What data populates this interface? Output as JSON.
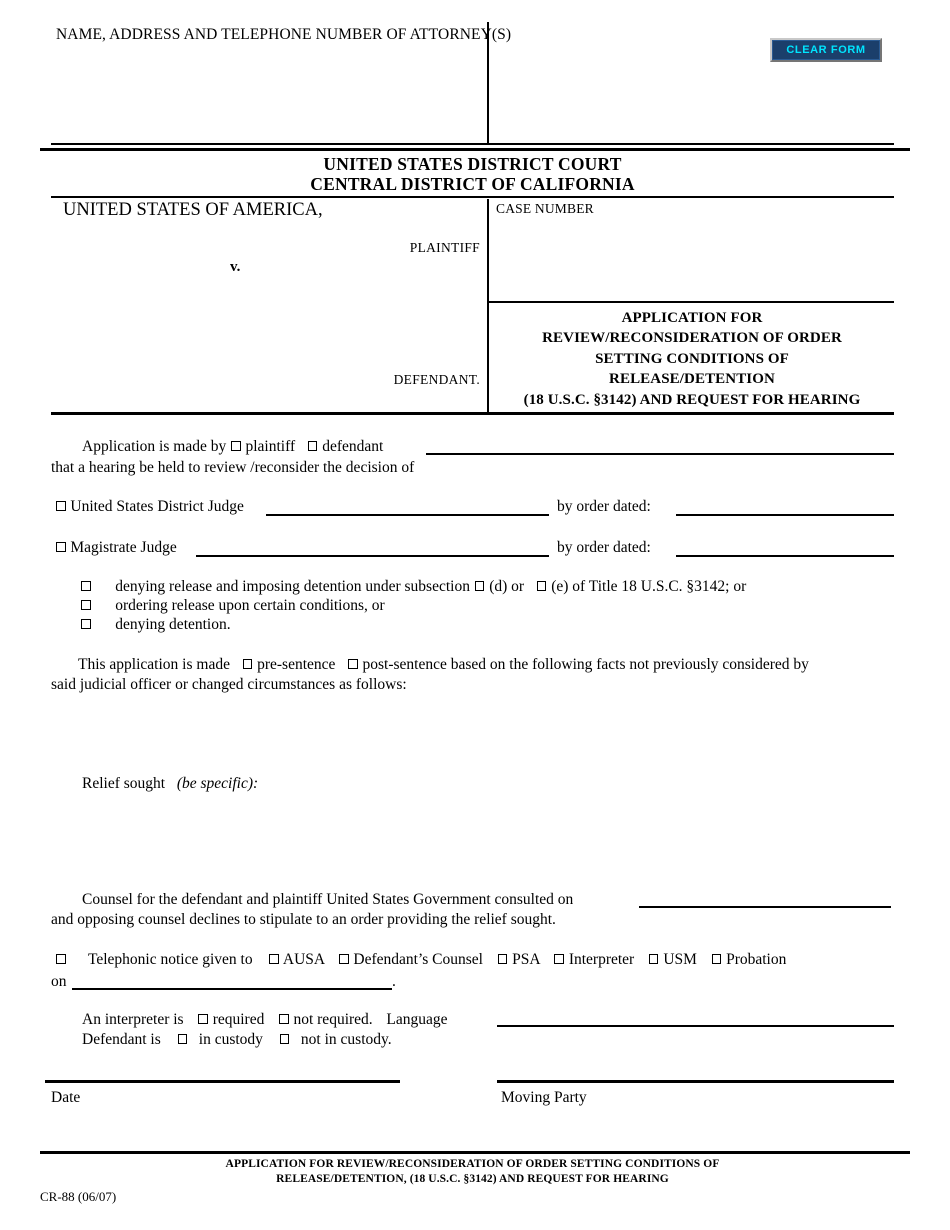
{
  "header": {
    "attorney_label": "NAME, ADDRESS AND TELEPHONE NUMBER OF ATTORNEY(S)",
    "clear_form_label": "CLEAR FORM"
  },
  "court": {
    "line1": "UNITED STATES DISTRICT COURT",
    "line2": "CENTRAL DISTRICT OF CALIFORNIA"
  },
  "caption": {
    "plaintiff_name": "UNITED STATES OF AMERICA,",
    "plaintiff_word": "PLAINTIFF",
    "versus": "v.",
    "defendant_word": "DEFENDANT.",
    "case_number_label": "CASE NUMBER",
    "case_number_value": "",
    "title_lines": [
      "APPLICATION FOR",
      "REVIEW/RECONSIDERATION OF ORDER",
      "SETTING CONDITIONS OF",
      "RELEASE/DETENTION",
      "(18 U.S.C. §3142) AND REQUEST FOR HEARING"
    ]
  },
  "application": {
    "made_by_prefix": "Application is made by",
    "plaintiff_option": "plaintiff",
    "defendant_option": "defendant",
    "made_by_value": "",
    "hearing_line": "that a hearing be held to review /reconsider the decision of",
    "district_judge_label": "United States District Judge",
    "district_judge_value": "",
    "district_order_dated_label": "by order dated:",
    "district_order_dated_value": "",
    "magistrate_judge_label": "Magistrate Judge",
    "magistrate_judge_value": "",
    "magistrate_order_dated_label": "by order dated:",
    "magistrate_order_dated_value": ""
  },
  "decision_options": {
    "item1_part1": "denying release and imposing detention under subsection",
    "item1_sub_d": "(d) or",
    "item1_sub_e": "(e) of Title 18 U.S.C. §3142; or",
    "item2": "ordering release upon certain conditions, or",
    "item3": "denying detention."
  },
  "sentence_section": {
    "prefix": "This application is made",
    "pre_sentence": "pre-sentence",
    "post_sentence": "post-sentence based on the following facts not previously considered by",
    "line2": "said judicial officer or changed circumstances as follows:",
    "facts_value": ""
  },
  "relief": {
    "label": "Relief sought",
    "label_italic": "(be specific):",
    "value": ""
  },
  "counsel": {
    "line1": "Counsel for the defendant and plaintiff United States Government consulted on",
    "consulted_on_value": "",
    "line2": "and opposing counsel declines to stipulate to an order providing the relief sought."
  },
  "telephonic": {
    "label": "Telephonic notice given to",
    "recipients": [
      "AUSA",
      "Defendant’s Counsel",
      "PSA",
      "Interpreter",
      "USM",
      "Probation"
    ],
    "on_label": "on",
    "on_value": "",
    "on_period": "."
  },
  "interpreter": {
    "prefix": "An interpreter is",
    "required": "required",
    "not_required": "not required.",
    "language_label": "Language",
    "language_value": ""
  },
  "custody": {
    "prefix": "Defendant is",
    "in_custody": "in custody",
    "not_in_custody": "not in custody."
  },
  "signature": {
    "date_label": "Date",
    "date_value": "",
    "moving_party_label": "Moving Party",
    "moving_party_value": ""
  },
  "footer": {
    "line1": "APPLICATION FOR REVIEW/RECONSIDERATION OF ORDER SETTING CONDITIONS OF",
    "line2": "RELEASE/DETENTION, (18 U.S.C. §3142) AND REQUEST FOR HEARING",
    "form_code": "CR-88 (06/07)"
  },
  "colors": {
    "button_bg": "#1b3f6b",
    "button_text": "#00e5ff"
  }
}
